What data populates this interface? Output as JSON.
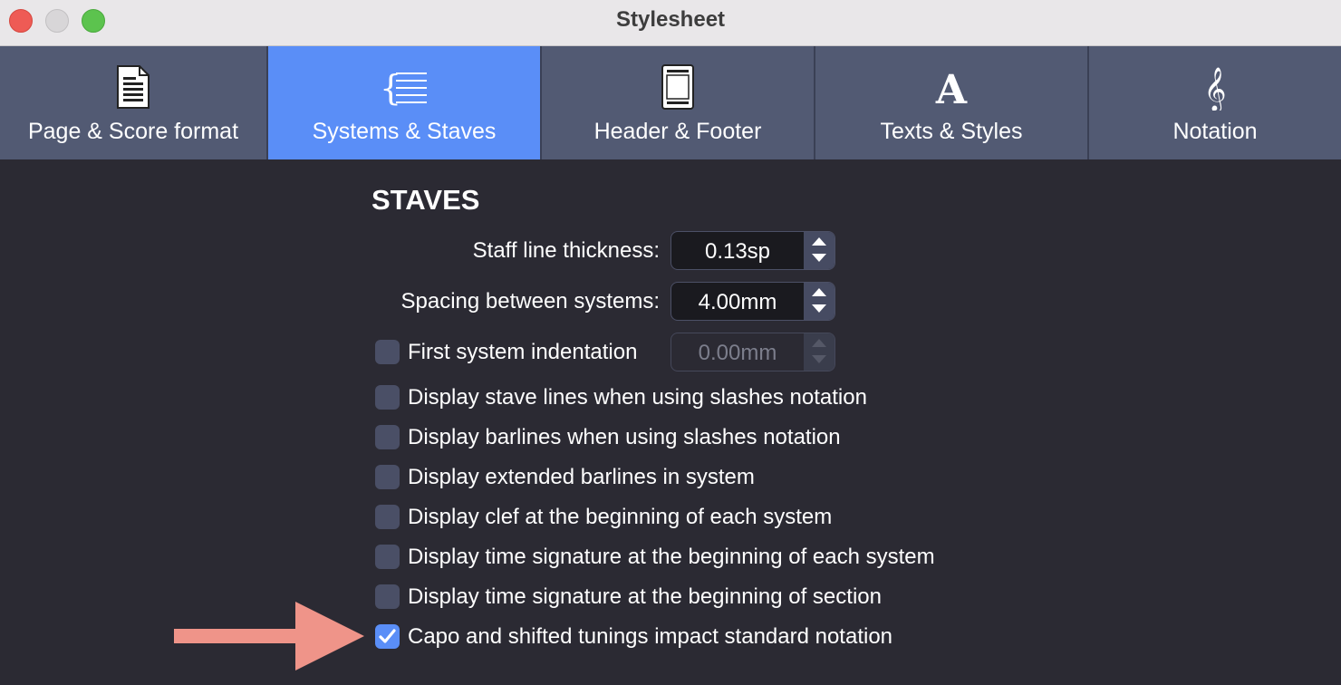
{
  "window": {
    "title": "Stylesheet"
  },
  "tabs": [
    {
      "label": "Page & Score format",
      "icon": "page-document-icon",
      "active": false
    },
    {
      "label": "Systems & Staves",
      "icon": "systems-brace-staves-icon",
      "active": true
    },
    {
      "label": "Header & Footer",
      "icon": "header-footer-page-icon",
      "active": false
    },
    {
      "label": "Texts & Styles",
      "icon": "letter-a-icon",
      "active": false
    },
    {
      "label": "Notation",
      "icon": "treble-clef-icon",
      "active": false
    }
  ],
  "section": {
    "title": "STAVES"
  },
  "fields": {
    "staff_line_thickness": {
      "label": "Staff line thickness:",
      "value": "0.13sp"
    },
    "spacing_between_systems": {
      "label": "Spacing between systems:",
      "value": "4.00mm"
    },
    "first_system_indentation": {
      "label": "First system indentation",
      "value": "0.00mm",
      "checked": false,
      "enabled": false
    }
  },
  "checkboxes": [
    {
      "label": "Display stave lines when using slashes notation",
      "checked": false
    },
    {
      "label": "Display barlines when using slashes notation",
      "checked": false
    },
    {
      "label": "Display extended barlines in system",
      "checked": false
    },
    {
      "label": "Display clef at the beginning of each system",
      "checked": false
    },
    {
      "label": "Display time signature at the beginning of each system",
      "checked": false
    },
    {
      "label": "Display time signature at the beginning of section",
      "checked": false
    },
    {
      "label": "Capo and shifted tunings impact standard notation",
      "checked": true
    }
  ],
  "colors": {
    "accent": "#5a8ef7",
    "tab_bar": "#525a73",
    "background": "#2b2a33",
    "annotation_arrow": "#ef9489"
  }
}
